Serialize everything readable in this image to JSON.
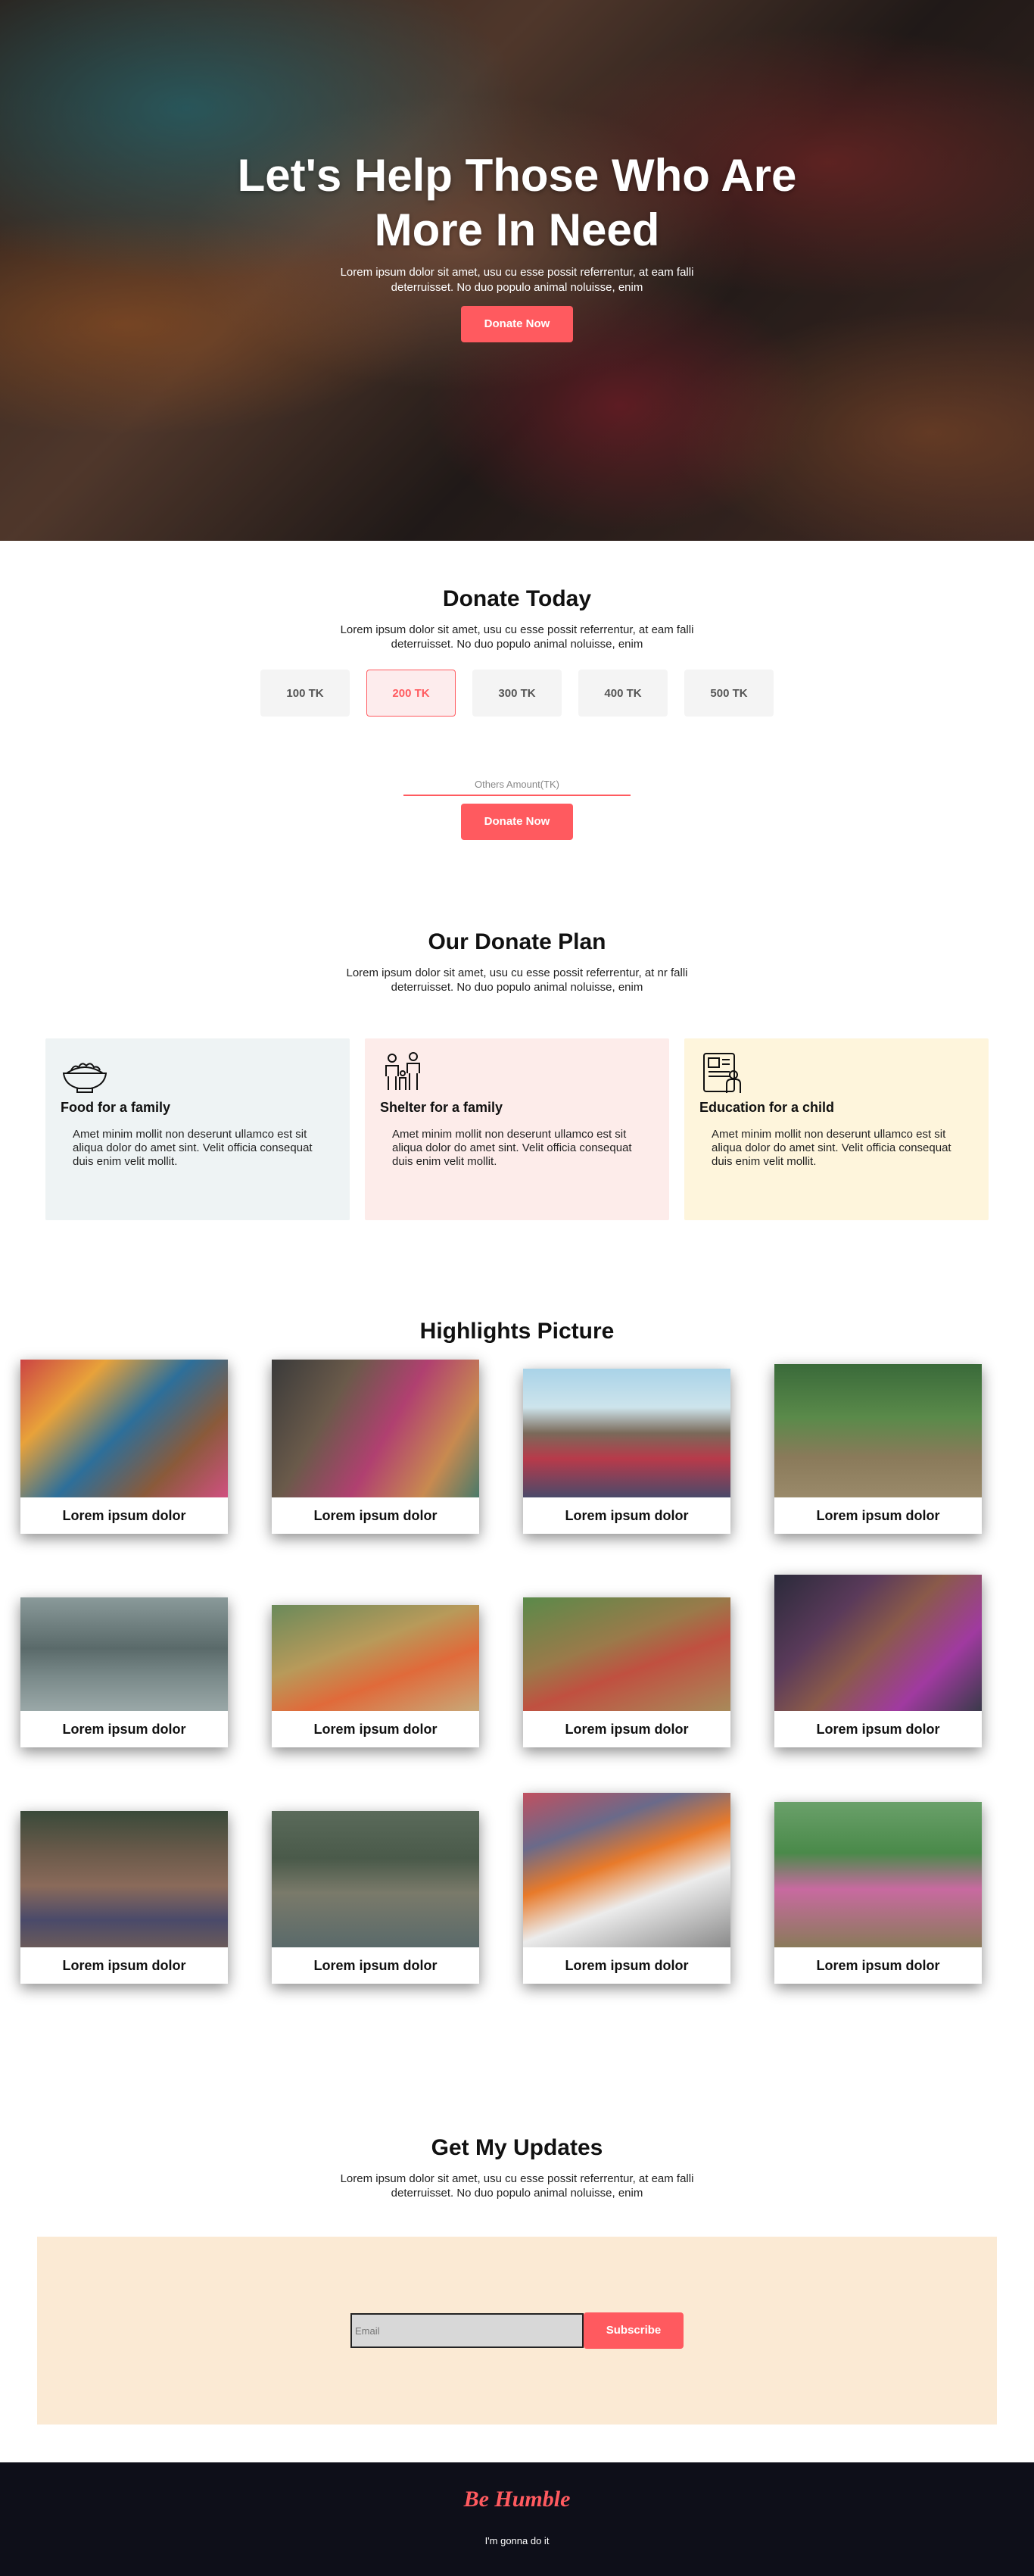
{
  "hero": {
    "title": "Let's Help Those Who Are More In Need",
    "subtitle": "Lorem ipsum dolor sit amet, usu cu esse possit referrentur, at eam falli deterruisset. No duo populo animal noluisse, enim",
    "button": "Donate Now"
  },
  "donate": {
    "title": "Donate Today",
    "subtitle": "Lorem ipsum dolor sit amet, usu cu esse possit referrentur, at eam falli deterruisset. No duo populo animal noluisse, enim",
    "amounts": [
      "100 TK",
      "200 TK",
      "300 TK",
      "400 TK",
      "500 TK"
    ],
    "selected_amount": "200 TK",
    "other_placeholder": "Others Amount(TK)",
    "button": "Donate Now"
  },
  "plan": {
    "title": "Our Donate Plan",
    "subtitle": "Lorem ipsum dolor sit amet, usu cu esse possit referrentur, at nr falli deterruisset. No duo populo animal noluisse, enim",
    "cards": [
      {
        "title": "Food for a family",
        "text": "Amet minim mollit non deserunt ullamco est sit aliqua dolor do amet sint. Velit officia consequat duis enim velit mollit.",
        "icon": "rice-bowl-icon"
      },
      {
        "title": "Shelter for a family",
        "text": "Amet minim mollit non deserunt ullamco est sit aliqua dolor do amet sint. Velit officia consequat duis enim velit mollit.",
        "icon": "family-icon"
      },
      {
        "title": "Education for a child",
        "text": "Amet minim mollit non deserunt ullamco est sit aliqua dolor do amet sint. Velit officia consequat duis enim velit mollit.",
        "icon": "tablet-study-icon"
      }
    ]
  },
  "highlights": {
    "title": "Highlights Picture",
    "caption": "Lorem ipsum dolor"
  },
  "updates": {
    "title": "Get My Updates",
    "subtitle": "Lorem ipsum dolor sit amet, usu cu esse possit referrentur, at eam falli deterruisset. No duo populo animal noluisse, enim",
    "email_placeholder": "Email",
    "button": "Subscribe"
  },
  "footer": {
    "brand": "Be Humble",
    "tagline": "I'm gonna do it"
  },
  "colors": {
    "accent": "#ff5a5f",
    "footer_bg": "#0e0f19",
    "subscribe_box": "#fbead4"
  }
}
